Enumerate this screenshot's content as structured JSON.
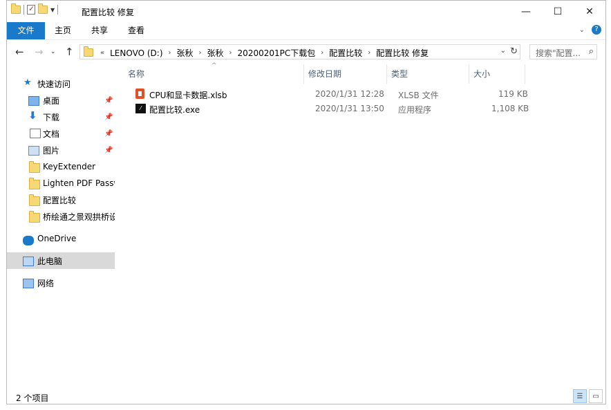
{
  "window": {
    "title": "配置比较 修复",
    "controls": {
      "minimize": "—",
      "maximize": "☐",
      "close": "✕"
    }
  },
  "ribbon": {
    "tabs": [
      {
        "label": "文件",
        "active": true
      },
      {
        "label": "主页"
      },
      {
        "label": "共享"
      },
      {
        "label": "查看"
      }
    ]
  },
  "address": {
    "prefix": "«",
    "crumbs": [
      "LENOVO (D:)",
      "张秋",
      "张秋",
      "20200201PC下载包",
      "配置比较",
      "配置比较 修复"
    ]
  },
  "search": {
    "placeholder": "搜索\"配置..."
  },
  "nav": {
    "quick_access": "快速访问",
    "items": [
      {
        "label": "桌面",
        "icon": "desktop-icon",
        "pinned": true
      },
      {
        "label": "下载",
        "icon": "download-icon",
        "pinned": true
      },
      {
        "label": "文档",
        "icon": "document-icon",
        "pinned": true
      },
      {
        "label": "图片",
        "icon": "pictures-icon",
        "pinned": true
      },
      {
        "label": "KeyExtender",
        "icon": "folder-icon"
      },
      {
        "label": "Lighten PDF Passw",
        "icon": "folder-icon"
      },
      {
        "label": "配置比较",
        "icon": "folder-icon"
      },
      {
        "label": "桥绘通之景观拱桥设",
        "icon": "folder-icon"
      }
    ],
    "onedrive": "OneDrive",
    "this_pc": "此电脑",
    "network": "网络"
  },
  "columns": {
    "name": "名称",
    "date": "修改日期",
    "type": "类型",
    "size": "大小"
  },
  "files": [
    {
      "name": "CPU和显卡数据.xlsb",
      "date": "2020/1/31 12:28",
      "type": "XLSB 文件",
      "size": "119 KB",
      "icon": "excel-file-icon"
    },
    {
      "name": "配置比较.exe",
      "date": "2020/1/31 13:50",
      "type": "应用程序",
      "size": "1,108 KB",
      "icon": "exe-file-icon"
    }
  ],
  "status": {
    "count": "2 个项目"
  }
}
